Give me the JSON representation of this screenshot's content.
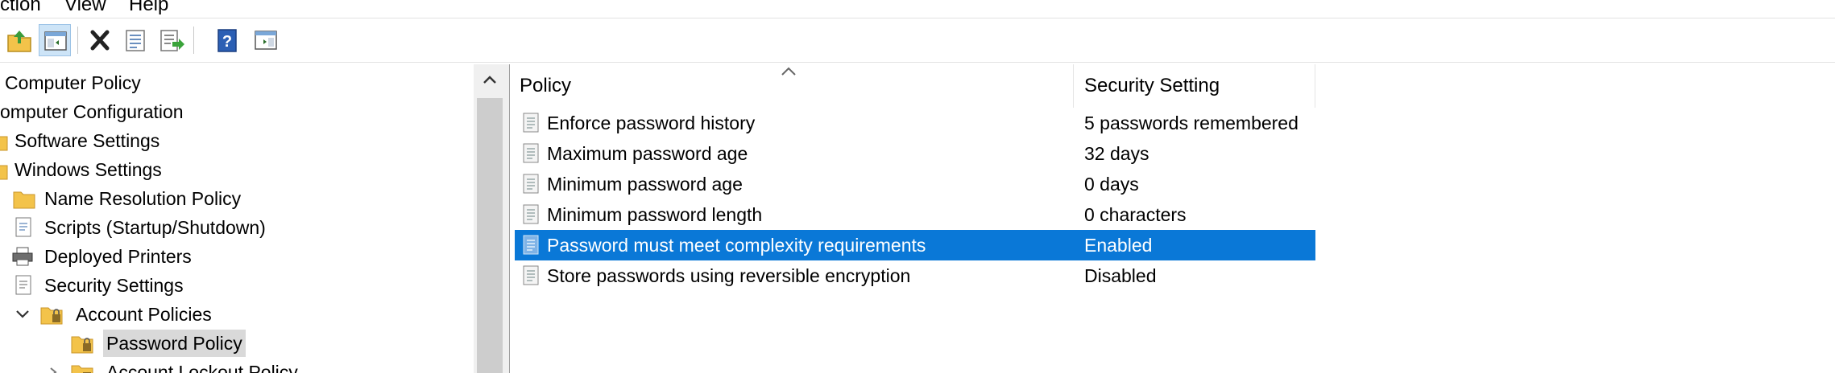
{
  "menu": [
    "ction",
    "View",
    "Help"
  ],
  "toolbar": {
    "icons": [
      "up-folder-icon",
      "show-hide-tree-icon",
      "delete-icon",
      "properties-icon",
      "export-list-icon",
      "help-icon",
      "show-hide-action-pane-icon"
    ]
  },
  "tree": {
    "items": [
      {
        "label": "Computer Policy"
      },
      {
        "label": "omputer Configuration"
      },
      {
        "label": "Software Settings"
      },
      {
        "label": "Windows Settings"
      },
      {
        "label": "Name Resolution Policy"
      },
      {
        "label": "Scripts (Startup/Shutdown)"
      },
      {
        "label": "Deployed Printers"
      },
      {
        "label": "Security Settings"
      },
      {
        "label": "Account Policies"
      },
      {
        "label": "Password Policy"
      },
      {
        "label": "Account Lockout Policy"
      }
    ]
  },
  "list": {
    "headers": {
      "policy": "Policy",
      "setting": "Security Setting"
    },
    "rows": [
      {
        "policy": "Enforce password history",
        "setting": "5 passwords remembered"
      },
      {
        "policy": "Maximum password age",
        "setting": "32 days"
      },
      {
        "policy": "Minimum password age",
        "setting": "0 days"
      },
      {
        "policy": "Minimum password length",
        "setting": "0 characters"
      },
      {
        "policy": "Password must meet complexity requirements",
        "setting": "Enabled"
      },
      {
        "policy": "Store passwords using reversible encryption",
        "setting": "Disabled"
      }
    ],
    "selected_row": 4
  },
  "colors": {
    "selection": "#0a78d7",
    "tree_selection": "#d9d9d9",
    "folder": "#f3c34a"
  }
}
